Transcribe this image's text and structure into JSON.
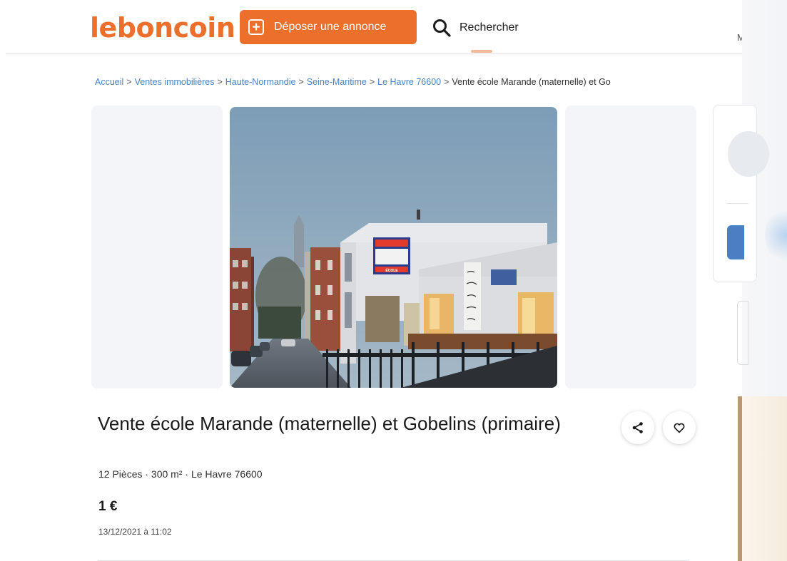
{
  "header": {
    "logo": "leboncoin",
    "post_button": {
      "icon": "plus-square-icon",
      "label": "Déposer une annonce"
    },
    "search": {
      "icon": "search-icon",
      "label": "Rechercher"
    },
    "right_text": "M"
  },
  "breadcrumb": {
    "items": [
      {
        "label": "Accueil"
      },
      {
        "label": "Ventes immobilières"
      },
      {
        "label": "Haute-Normandie"
      },
      {
        "label": "Seine-Maritime"
      },
      {
        "label": "Le Havre 76600"
      }
    ],
    "separator": ">",
    "current": "Vente école Marande (maternelle) et Go"
  },
  "listing": {
    "photo_sign_text": "ÉCOLE",
    "title": "Vente école Marande (maternelle) et Gobelins (primaire)",
    "details": "12 Pièces · 300 m² · Le Havre 76600",
    "price": "1 €",
    "date": "13/12/2021 à 11:02"
  },
  "actions": {
    "share_icon": "share-icon",
    "favorite_icon": "heart-icon"
  },
  "colors": {
    "brand": "#ec6f2b",
    "link": "#4a82c0",
    "panel": "#f3f5f8"
  }
}
